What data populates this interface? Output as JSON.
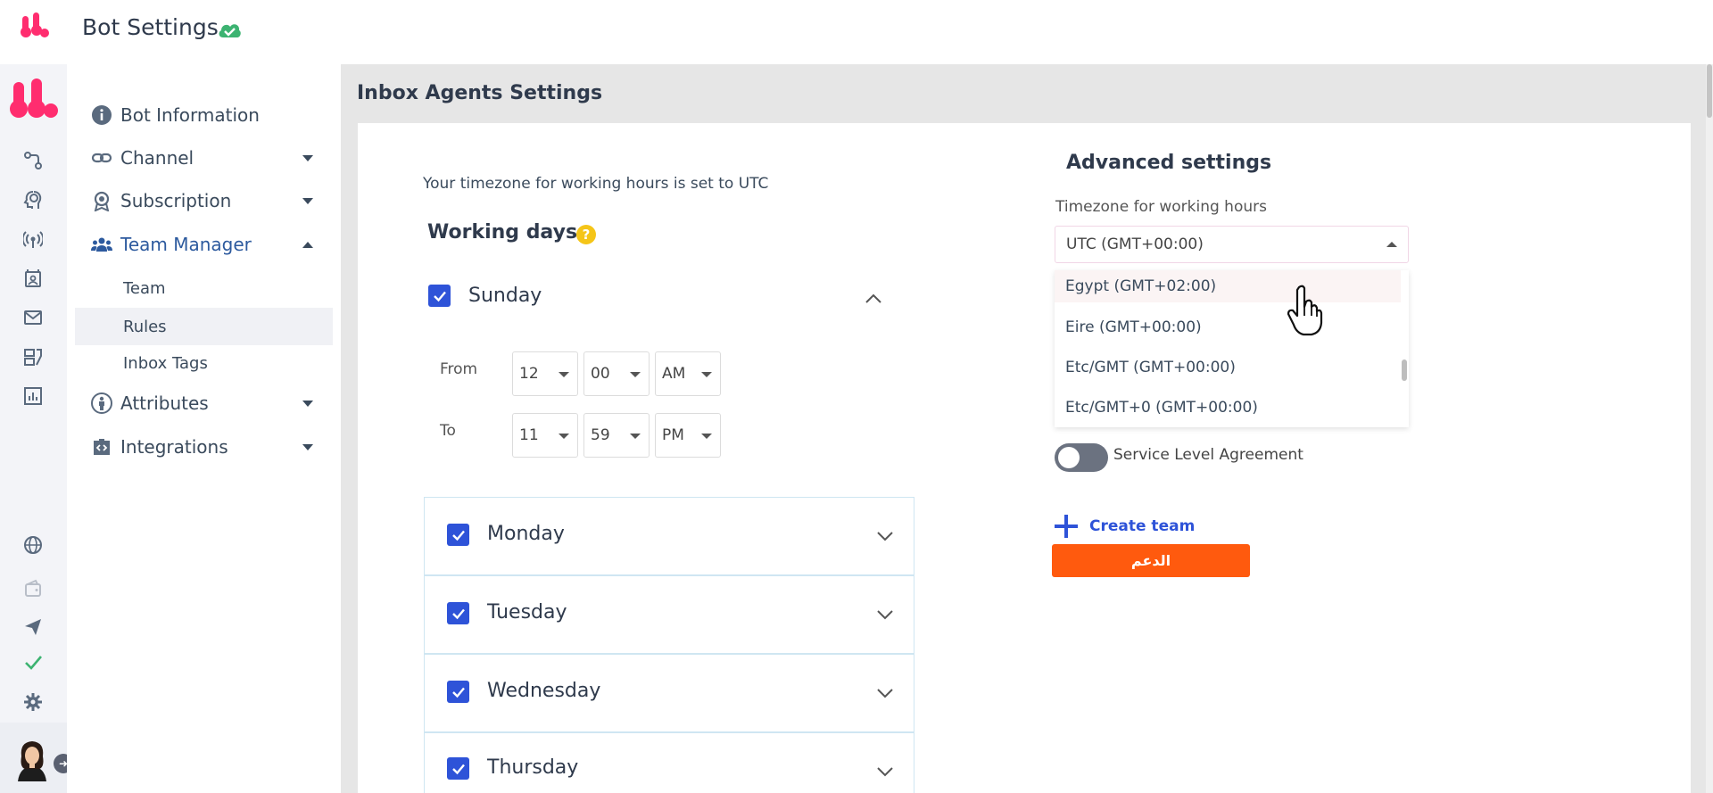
{
  "header": {
    "title": "Bot Settings",
    "status_icon": "cloud-check-icon"
  },
  "colors": {
    "brand": "#ff2d6f",
    "accent": "#2e53d8",
    "success": "#3cb371",
    "cta": "#ff5a0e"
  },
  "nav": {
    "items": [
      {
        "label": "Bot Information",
        "icon": "info-icon"
      },
      {
        "label": "Channel",
        "icon": "link-icon"
      },
      {
        "label": "Subscription",
        "icon": "badge-icon"
      },
      {
        "label": "Team Manager",
        "icon": "team-icon"
      },
      {
        "label": "Attributes",
        "icon": "person-icon"
      },
      {
        "label": "Integrations",
        "icon": "code-icon"
      }
    ],
    "sub_items": [
      {
        "label": "Team"
      },
      {
        "label": "Rules"
      },
      {
        "label": "Inbox Tags"
      }
    ]
  },
  "main": {
    "title": "Inbox Agents Settings",
    "timezone_note": "Your timezone for working hours is set to UTC",
    "working_days_title": "Working days",
    "help_glyph": "?",
    "sunday": {
      "label": "Sunday",
      "from_label": "From",
      "to_label": "To",
      "from": {
        "hour": "12",
        "minute": "00",
        "period": "AM"
      },
      "to": {
        "hour": "11",
        "minute": "59",
        "period": "PM"
      }
    },
    "days": [
      {
        "label": "Monday"
      },
      {
        "label": "Tuesday"
      },
      {
        "label": "Wednesday"
      },
      {
        "label": "Thursday"
      }
    ],
    "advanced": {
      "title": "Advanced settings",
      "timezone_label": "Timezone for working hours",
      "timezone_value": "UTC (GMT+00:00)",
      "timezone_options": [
        "Egypt (GMT+02:00)",
        "Eire (GMT+00:00)",
        "Etc/GMT (GMT+00:00)",
        "Etc/GMT+0 (GMT+00:00)"
      ],
      "sla_label": "Service Level Agreement",
      "create_team_label": "Create team",
      "support_button": "الدعم"
    }
  }
}
